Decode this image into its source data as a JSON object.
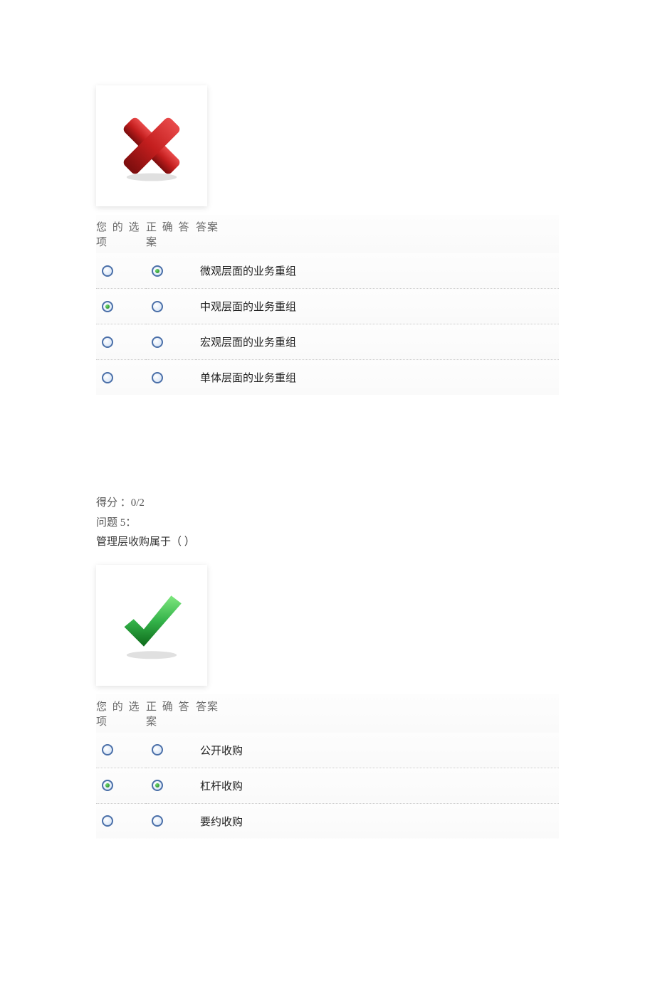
{
  "headers": {
    "your_choice": "您 的 选",
    "correct_answer_top": "正 确 答",
    "your_choice_sub": "项",
    "correct_answer_sub": "案",
    "answer_text": "答案"
  },
  "question1": {
    "result": "wrong",
    "rows": [
      {
        "user_selected": false,
        "correct_selected": true,
        "text": "微观层面的业务重组"
      },
      {
        "user_selected": true,
        "correct_selected": false,
        "text": "中观层面的业务重组"
      },
      {
        "user_selected": false,
        "correct_selected": false,
        "text": "宏观层面的业务重组"
      },
      {
        "user_selected": false,
        "correct_selected": false,
        "text": "单体层面的业务重组"
      }
    ]
  },
  "question2": {
    "score_label": "得分 ：",
    "score_value": "0/2",
    "prompt_label": "问题 5：",
    "prompt_text": "管理层收购属于（ ）",
    "result": "correct",
    "rows": [
      {
        "user_selected": false,
        "correct_selected": false,
        "text": "公开收购"
      },
      {
        "user_selected": true,
        "correct_selected": true,
        "text": "杠杆收购"
      },
      {
        "user_selected": false,
        "correct_selected": false,
        "text": "要约收购"
      }
    ]
  }
}
